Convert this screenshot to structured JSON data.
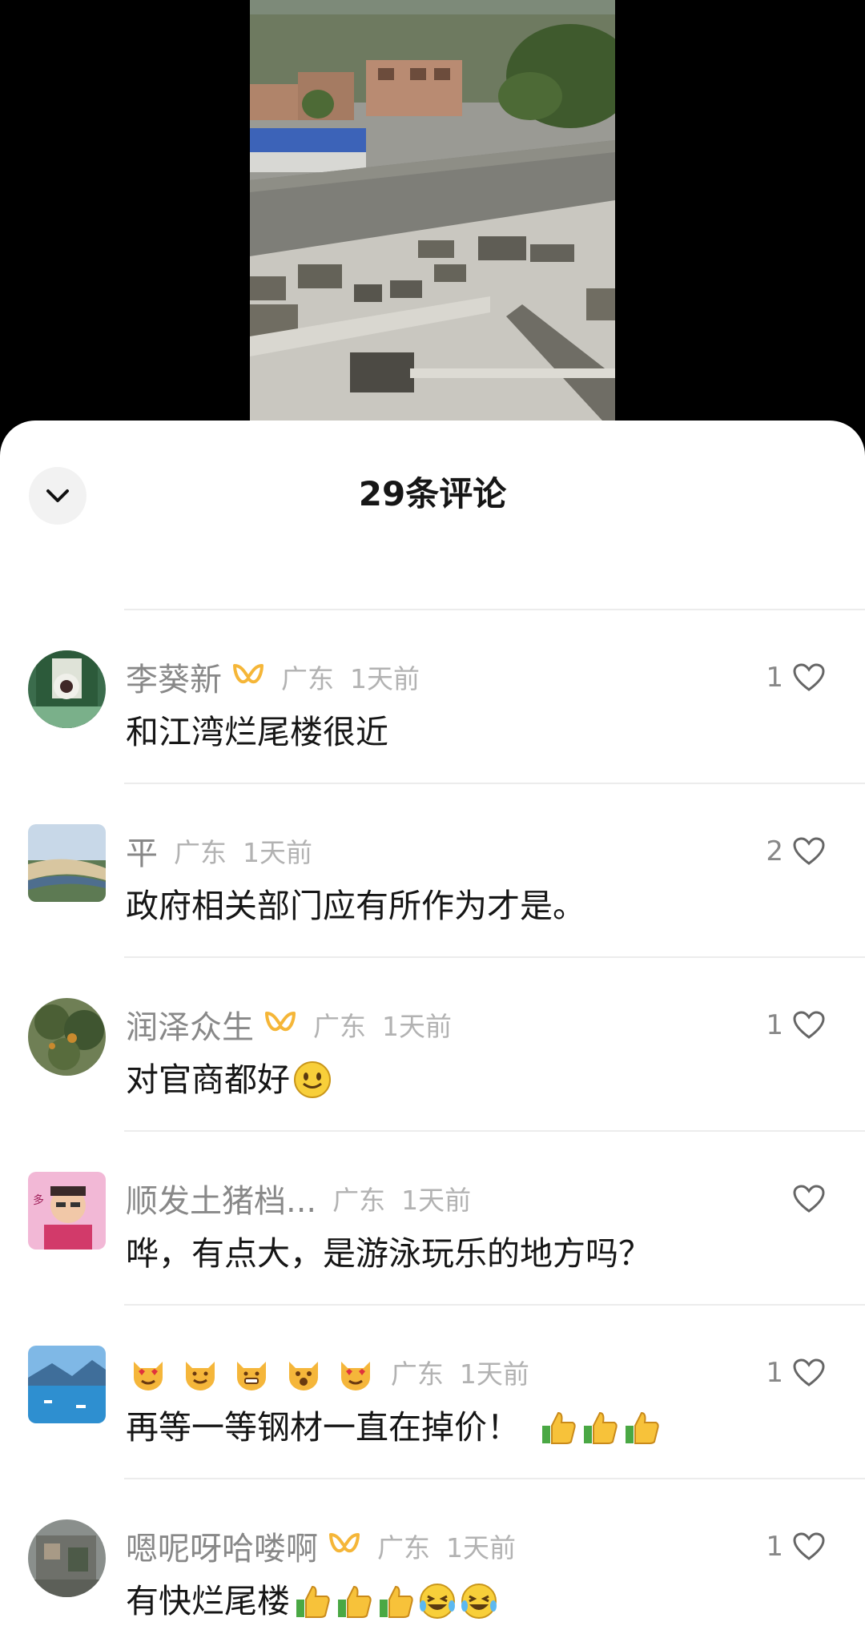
{
  "sheet": {
    "title": "29条评论",
    "collapse_icon": "chevron-down-icon"
  },
  "comments": [
    {
      "username": "李葵新",
      "has_badge": true,
      "region": "广东",
      "time": "1天前",
      "text": "和江湾烂尾楼很近",
      "likes": "1"
    },
    {
      "username": "平",
      "has_badge": false,
      "region": "广东",
      "time": "1天前",
      "text": "政府相关部门应有所作为才是。",
      "likes": "2"
    },
    {
      "username": "润泽众生",
      "has_badge": true,
      "region": "广东",
      "time": "1天前",
      "text": "对官商都好",
      "likes": "1"
    },
    {
      "username": "顺发土猪档...",
      "has_badge": false,
      "region": "广东",
      "time": "1天前",
      "text": "哗，有点大，是游泳玩乐的地方吗？",
      "likes": ""
    },
    {
      "username": "",
      "has_badge": false,
      "region": "广东",
      "time": "1天前",
      "text": "再等一等钢材一直在掉价！",
      "likes": "1"
    },
    {
      "username": "嗯呢呀哈喽啊",
      "has_badge": true,
      "region": "广东",
      "time": "1天前",
      "text": "有快烂尾楼",
      "likes": "1"
    }
  ],
  "colors": {
    "badge": "#f5b638",
    "muted": "#b2b2b2",
    "text": "#161616"
  }
}
